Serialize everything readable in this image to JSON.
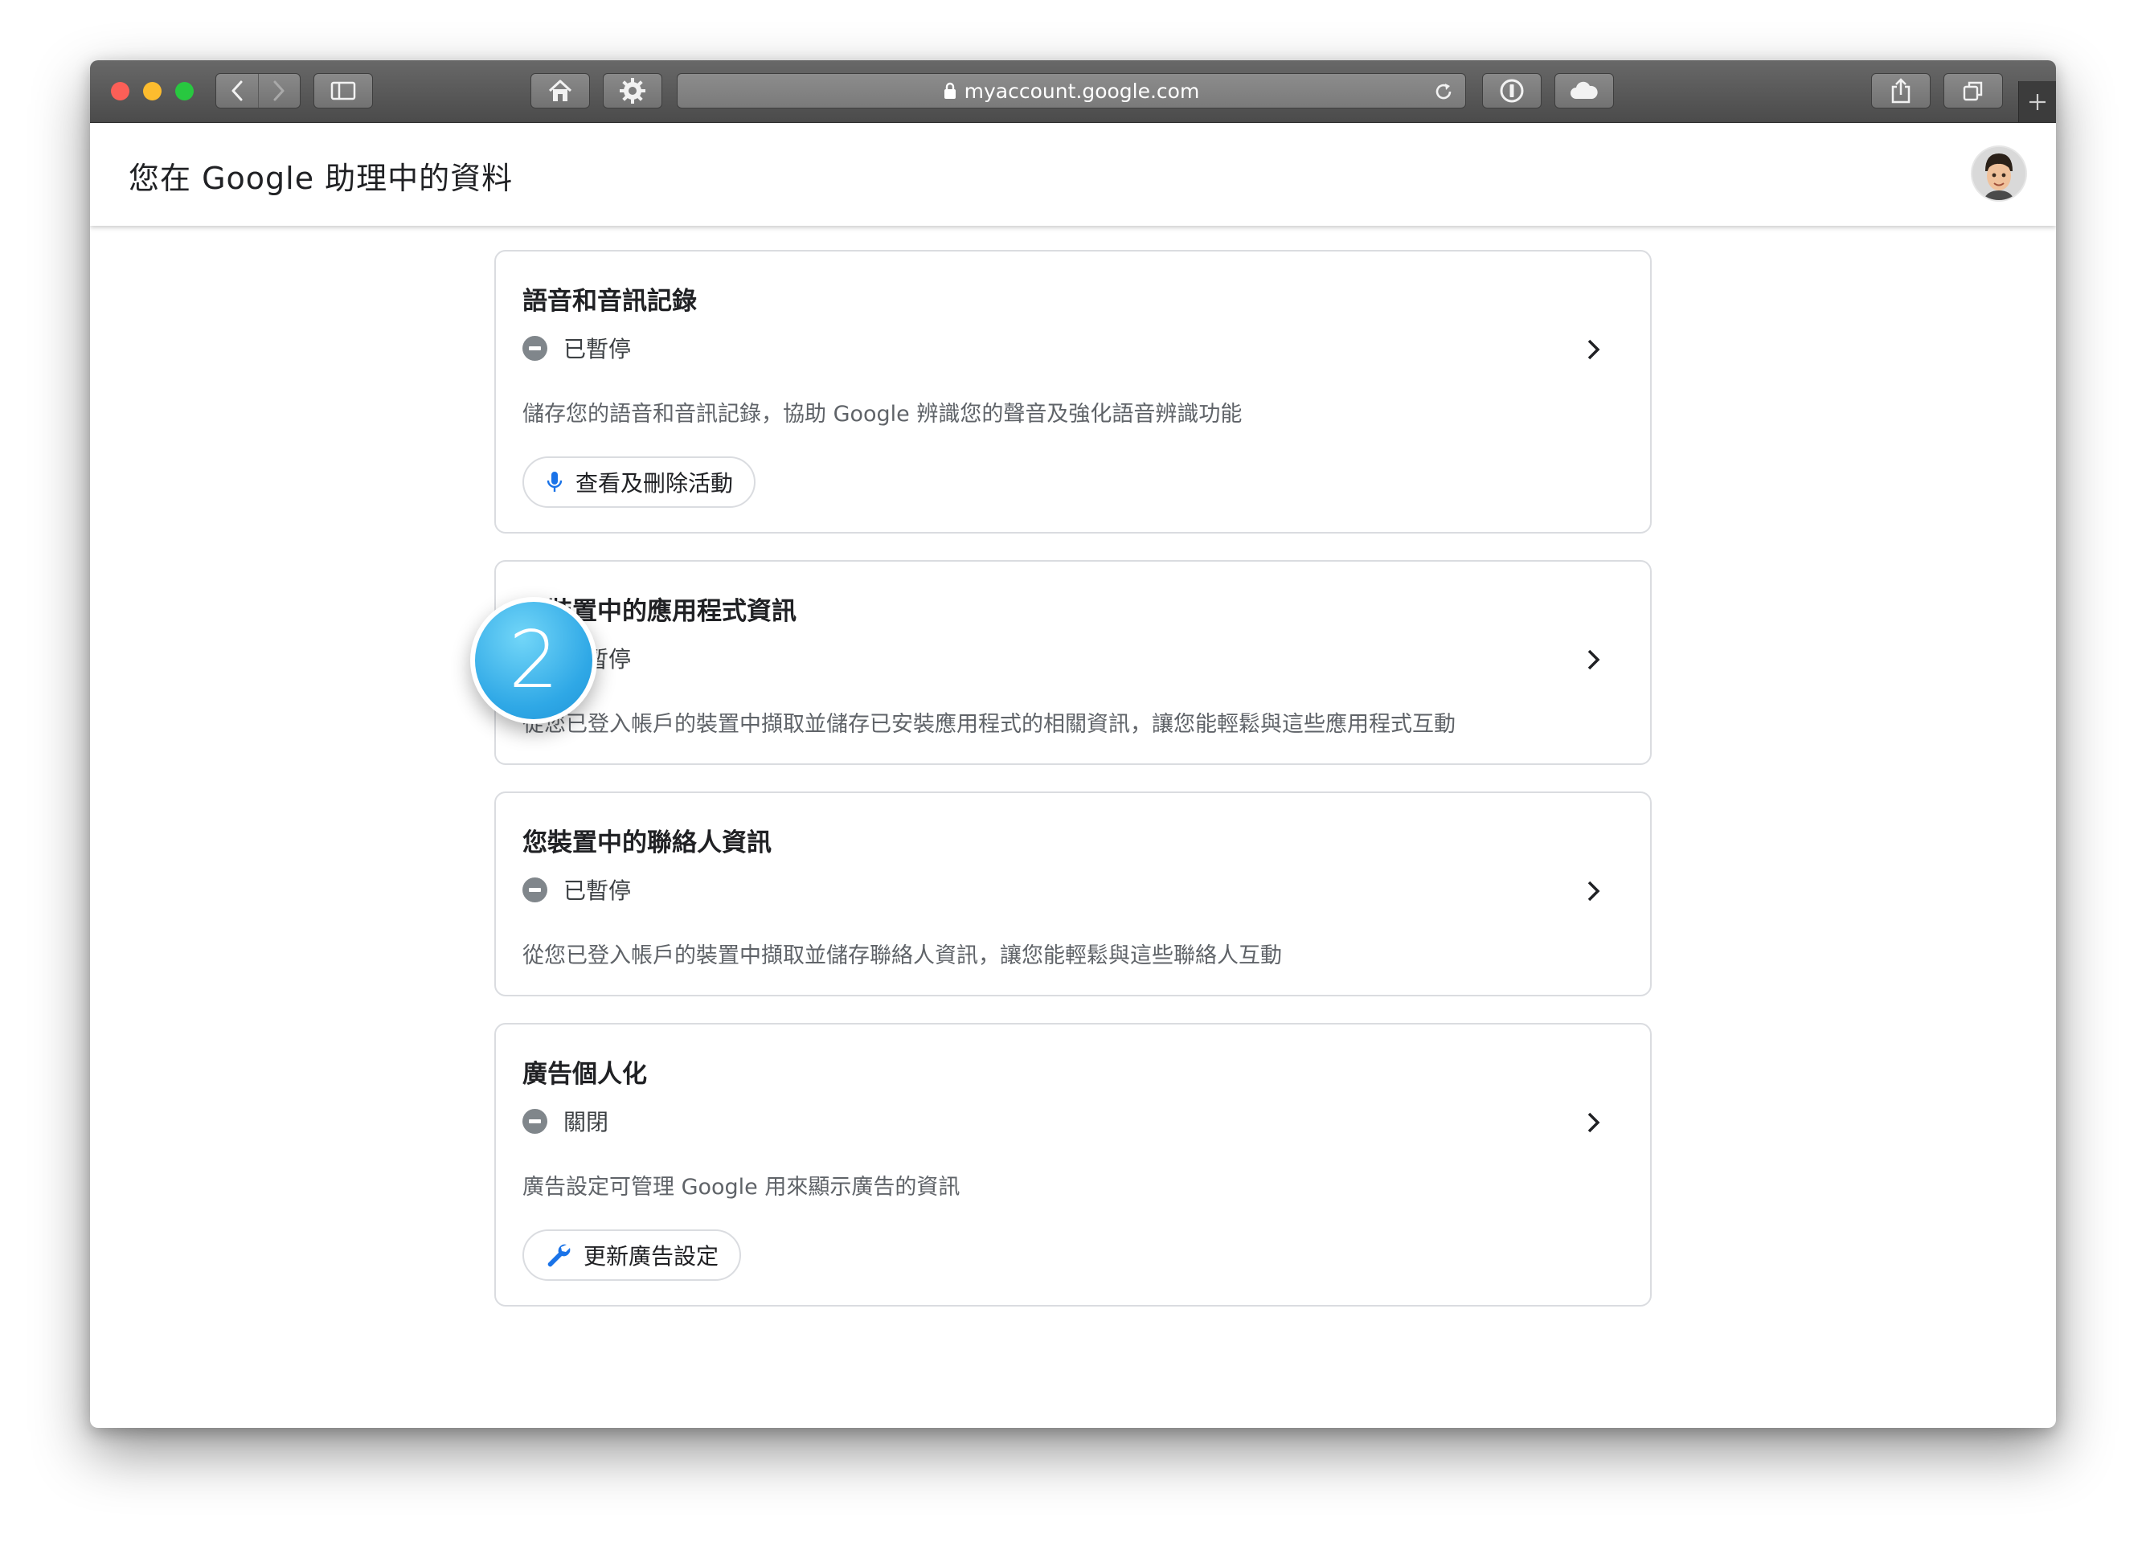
{
  "browser": {
    "url": "myaccount.google.com"
  },
  "page": {
    "title": "您在 Google 助理中的資料"
  },
  "step_badge": "2",
  "cards": [
    {
      "title": "語音和音訊記錄",
      "status": "已暫停",
      "description": "儲存您的語音和音訊記錄，協助 Google 辨識您的聲音及強化語音辨識功能",
      "button": {
        "label": "查看及刪除活動",
        "icon": "microphone-icon"
      }
    },
    {
      "title": "您裝置中的應用程式資訊",
      "status": "已暫停",
      "description": "從您已登入帳戶的裝置中擷取並儲存已安裝應用程式的相關資訊，讓您能輕鬆與這些應用程式互動"
    },
    {
      "title": "您裝置中的聯絡人資訊",
      "status": "已暫停",
      "description": "從您已登入帳戶的裝置中擷取並儲存聯絡人資訊，讓您能輕鬆與這些聯絡人互動"
    },
    {
      "title": "廣告個人化",
      "status": "關閉",
      "description": "廣告設定可管理 Google 用來顯示廣告的資訊",
      "button": {
        "label": "更新廣告設定",
        "icon": "wrench-icon"
      }
    }
  ],
  "colors": {
    "mic_blue": "#1a73e8",
    "status_gray": "#80868b",
    "badge_blue": "#2fa8e6"
  }
}
